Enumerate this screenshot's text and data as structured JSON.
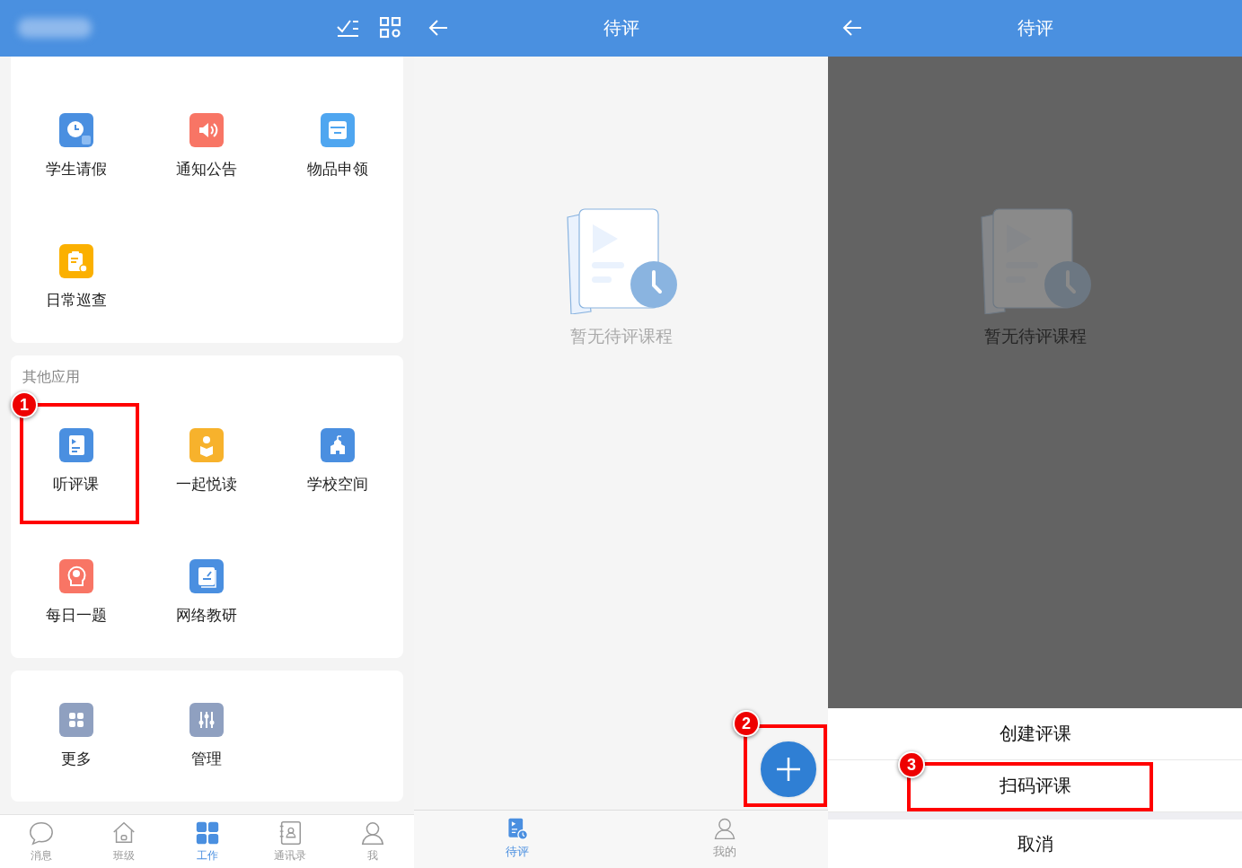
{
  "work_screen": {
    "cards": [
      {
        "apps": [
          {
            "label": "学生请假",
            "color": "#4a8fe0"
          },
          {
            "label": "通知公告",
            "color": "#f87565"
          },
          {
            "label": "物品申领",
            "color": "#4fa6f0"
          },
          {
            "label": "日常巡查",
            "color": "#fbb000"
          }
        ]
      },
      {
        "title": "其他应用",
        "apps": [
          {
            "label": "听评课",
            "color": "#4a8fe0",
            "callout": "1"
          },
          {
            "label": "一起悦读",
            "color": "#f7b22c"
          },
          {
            "label": "学校空间",
            "color": "#4a8fe0"
          },
          {
            "label": "每日一题",
            "color": "#f87565"
          },
          {
            "label": "网络教研",
            "color": "#4a8fe0"
          }
        ]
      },
      {
        "apps": [
          {
            "label": "更多",
            "color": "#8fa0c0"
          },
          {
            "label": "管理",
            "color": "#8fa0c0"
          }
        ]
      }
    ],
    "tabs": [
      {
        "label": "消息",
        "selected": false
      },
      {
        "label": "班级",
        "selected": false
      },
      {
        "label": "工作",
        "selected": true
      },
      {
        "label": "通讯录",
        "selected": false
      },
      {
        "label": "我",
        "selected": false
      }
    ]
  },
  "pending_screen": {
    "title": "待评",
    "empty_text": "暂无待评课程",
    "fab": {
      "callout": "2"
    },
    "tabs": [
      {
        "label": "待评",
        "selected": true
      },
      {
        "label": "我的",
        "selected": false
      }
    ]
  },
  "sheet_screen": {
    "title": "待评",
    "empty_text": "暂无待评课程",
    "options": [
      {
        "label": "创建评课",
        "kind": "action"
      },
      {
        "label": "扫码评课",
        "kind": "action",
        "callout": "3"
      },
      {
        "label": "取消",
        "kind": "cancel"
      }
    ]
  }
}
